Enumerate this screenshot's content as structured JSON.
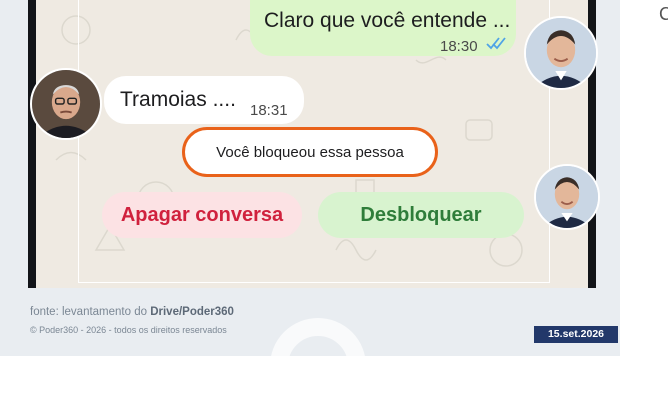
{
  "chat": {
    "messages": [
      {
        "text": "Claro que você entende ...",
        "time": "18:30",
        "direction": "outgoing",
        "status": "read"
      },
      {
        "text": "Tramoias ....",
        "time": "18:31",
        "direction": "incoming"
      }
    ],
    "system_notice": "Você bloqueou essa pessoa",
    "actions": {
      "delete_label": "Apagar conversa",
      "unblock_label": "Desbloquear"
    }
  },
  "footer": {
    "source_prefix": "fonte: levantamento do ",
    "source_name": "Drive/Poder360",
    "copyright": "© Poder360 - 2026 - todos os direitos reservados",
    "date": "15.set.2026"
  },
  "edge_glyph": "C",
  "colors": {
    "notice_outline": "#e9621a",
    "outgoing_bubble": "#dcf6c9",
    "delete_text": "#d0213d",
    "unblock_text": "#2f7d3a",
    "date_badge": "#22386a",
    "read_ticks": "#4fa3e6"
  }
}
